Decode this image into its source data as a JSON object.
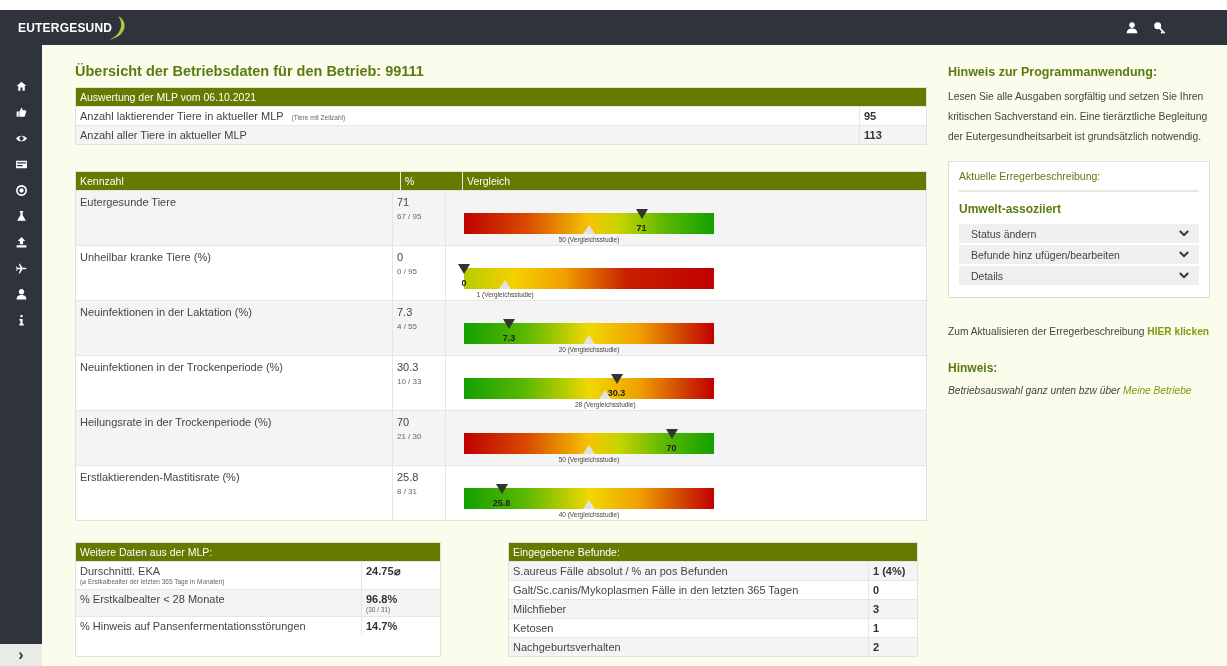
{
  "header": {
    "logo": "EUTERGESUND"
  },
  "sidebar": {
    "toggle": "›"
  },
  "title": "Übersicht der Betriebsdaten für den Betrieb: 99111",
  "mlp_table": {
    "heading": "Auswertung der MLP vom 06.10.2021",
    "rows": [
      {
        "label": "Anzahl laktierender Tiere in aktueller MLP",
        "note": "(Tiere mit Zellzahl)",
        "value": "95"
      },
      {
        "label": "Anzahl aller Tiere in aktueller MLP",
        "value": "113"
      }
    ]
  },
  "kennzahl_table": {
    "columns": [
      "Kennzahl",
      "%",
      "Vergleich"
    ],
    "rows": [
      {
        "label": "Eutergesunde Tiere",
        "value": "71",
        "ratio": "67 / 95",
        "gauge": {
          "kind": "rising",
          "marker": {
            "label": "71",
            "level": 0.71
          },
          "reference": {
            "label": "50 (Vergleichsstudie)",
            "level": 0.5
          }
        }
      },
      {
        "label": "Unheilbar kranke Tiere (%)",
        "value": "0",
        "ratio": "0 / 95",
        "gauge": {
          "kind": "falling_short",
          "marker": {
            "label": "0",
            "level": 0
          },
          "reference": {
            "label": "1 (Vergleichsstudie)",
            "level": 0.165
          }
        }
      },
      {
        "label": "Neuinfektionen in der Laktation (%)",
        "value": "7.3",
        "ratio": "4 / 55",
        "gauge": {
          "kind": "falling",
          "marker": {
            "label": "7.3",
            "level": 0.18
          },
          "reference": {
            "label": "20 (Vergleichsstudie)",
            "level": 0.5
          }
        }
      },
      {
        "label": "Neuinfektionen in der Trockenperiode (%)",
        "value": "30.3",
        "ratio": "10 / 33",
        "gauge": {
          "kind": "falling",
          "marker": {
            "label": "30.3",
            "level": 0.61
          },
          "reference": {
            "label": "28 (Vergleichsstudie)",
            "level": 0.565
          }
        }
      },
      {
        "label": "Heilungsrate in der Trockenperiode (%)",
        "value": "70",
        "ratio": "21 / 30",
        "gauge": {
          "kind": "rising",
          "marker": {
            "label": "70",
            "level": 0.83
          },
          "reference": {
            "label": "50 (Vergleichsstudie)",
            "level": 0.5
          }
        }
      },
      {
        "label": "Erstlaktierenden-Mastitisrate (%)",
        "value": "25.8",
        "ratio": "8 / 31",
        "gauge": {
          "kind": "falling",
          "marker": {
            "label": "25.8",
            "level": 0.15
          },
          "reference": {
            "label": "40 (Vergleichsstudie)",
            "level": 0.5
          }
        }
      }
    ]
  },
  "mlp_more": {
    "heading": "Weitere Daten aus der MLP:",
    "rows": [
      {
        "label": "Durschnittl. EKA",
        "note": "(⌀ Erstkalbealter der letzten 365 Tage in Monaten)",
        "value": "24.75⌀"
      },
      {
        "label": "% Erstkalbealter < 28 Monate",
        "value": "96.8%",
        "value_note": "(30 / 31)"
      },
      {
        "label": "% Hinweis auf Pansenfermentationsstörungen",
        "value": "14.7%"
      }
    ]
  },
  "findings": {
    "heading": "Eingegebene Befunde:",
    "rows": [
      {
        "label": "S.aureus Fälle absolut / % an pos Befunden",
        "value": "1 (4%)"
      },
      {
        "label": "Galt/Sc.canis/Mykoplasmen Fälle in den letzten 365 Tagen",
        "value": "0"
      },
      {
        "label": "Milchfieber",
        "value": "3"
      },
      {
        "label": "Ketosen",
        "value": "1"
      },
      {
        "label": "Nachgeburtsverhalten",
        "value": "2"
      }
    ]
  },
  "hint_panel": {
    "title": "Hinweis zur Programmanwendung:",
    "text": "Lesen Sie alle Ausgaben sorgfältig und setzen Sie Ihren kritischen Sachverstand ein. Eine tierärztliche Begleitung der Eutergesundheitsarbeit ist grundsätzlich notwendig.",
    "pathogen_box": {
      "label": "Aktuelle Erregerbeschreibung:",
      "value": "Umwelt-assoziiert",
      "sections": [
        {
          "label": "Status ändern",
          "expanded": false
        },
        {
          "label": "Befunde hinz ufügen/bearbeiten",
          "expanded": false
        },
        {
          "label": "Details",
          "expanded": false
        }
      ]
    },
    "update": {
      "text": "Zum Aktualisieren der Erregerbeschreibung",
      "link": "HIER klicken"
    },
    "note_title": "Hinweis:",
    "note": {
      "text": "Betriebsauswahl ganz unten bzw über",
      "link": "Meine Betriebe"
    }
  }
}
